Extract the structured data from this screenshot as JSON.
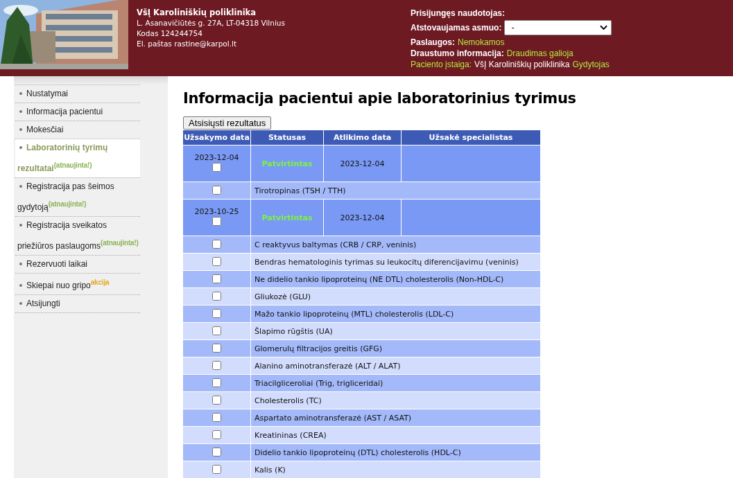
{
  "header": {
    "org_name": "VšĮ Karoliniškių poliklinika",
    "address": "L. Asanavičiūtės g. 27A, LT-04318 Vilnius",
    "code": "Kodas 124244754",
    "email": "El. paštas rastine@karpol.lt",
    "user_label": "Prisijungęs naudotojas:",
    "representative": {
      "label": "Atstovaujamas asmuo:",
      "value": "-"
    },
    "services": {
      "label": "Paslaugos:",
      "value": "Nemokamos"
    },
    "insurance": {
      "label": "Draustumo informacija:",
      "value": "Draudimas galioja"
    },
    "institution": {
      "label": "Paciento įstaiga:",
      "value": "VšĮ Karoliniškių poliklinika",
      "role": "Gydytojas"
    }
  },
  "sidebar": {
    "items": [
      {
        "label": "Nustatymai",
        "selected": false
      },
      {
        "label": "Informacija pacientui",
        "selected": false
      },
      {
        "label": "Mokesčiai",
        "selected": false
      },
      {
        "label": "Laboratorinių tyrimų rezultatai",
        "selected": true,
        "note": {
          "text": "(atnaujinta!)",
          "color": "#8cb455"
        }
      },
      {
        "label": "Registracija pas šeimos gydytoją",
        "selected": false,
        "note": {
          "text": "(atnaujinta!)",
          "color": "#8cb455"
        }
      },
      {
        "label": "Registracija sveikatos priežiūros paslaugoms",
        "selected": false,
        "note": {
          "text": "(atnaujinta!)",
          "color": "#8cb455"
        }
      },
      {
        "label": "Rezervuoti laikai",
        "selected": false
      },
      {
        "label": "Skiepai nuo gripo",
        "selected": false,
        "note": {
          "text": "akcija",
          "color": "#e0a81e"
        }
      },
      {
        "label": "Atsijungti",
        "selected": false
      }
    ]
  },
  "title": "Informacija pacientui apie laboratorinius tyrimus",
  "download_button": "Atsisiųsti rezultatus",
  "table": {
    "columns": [
      "Užsakymo data",
      "Statusas",
      "Atlikimo data",
      "Užsakė specialistas"
    ],
    "orders": [
      {
        "order_date": "2023-12-04",
        "checked": false,
        "status": "Patvirtintas",
        "done_date": "2023-12-04",
        "tests": [
          {
            "name": "Tirotropinas (TSH / TTH)",
            "checked": false
          }
        ]
      },
      {
        "order_date": "2023-10-25",
        "checked": false,
        "status": "Patvirtintas",
        "done_date": "2023-12-04",
        "tests": [
          {
            "name": "C reaktyvus baltymas (CRB / CRP, veninis)",
            "checked": false
          },
          {
            "name": "Bendras hematologinis tyrimas su leukocitų diferencijavimu (veninis)",
            "checked": false
          },
          {
            "name": "Ne didelio tankio lipoproteinų (NE DTL) cholesterolis (Non-HDL-C)",
            "checked": false
          },
          {
            "name": "Gliukozė (GLU)",
            "checked": false
          },
          {
            "name": "Mažo tankio lipoproteinų (MTL) cholesterolis (LDL-C)",
            "checked": false
          },
          {
            "name": "Šlapimo rūgštis (UA)",
            "checked": false
          },
          {
            "name": "Glomerulų filtracijos greitis (GFG)",
            "checked": false
          },
          {
            "name": "Alanino aminotransferazė (ALT / ALAT)",
            "checked": false
          },
          {
            "name": "Triacilgliceroliai (Trig, trigliceridai)",
            "checked": false
          },
          {
            "name": "Cholesterolis (TC)",
            "checked": false
          },
          {
            "name": "Aspartato aminotransferazė (AST / ASAT)",
            "checked": false
          },
          {
            "name": "Kreatininas (CREA)",
            "checked": false
          },
          {
            "name": "Didelio tankio lipoproteinų (DTL) cholesterolis (HDL-C)",
            "checked": false
          },
          {
            "name": "Kalis (K)",
            "checked": false
          }
        ]
      }
    ]
  }
}
